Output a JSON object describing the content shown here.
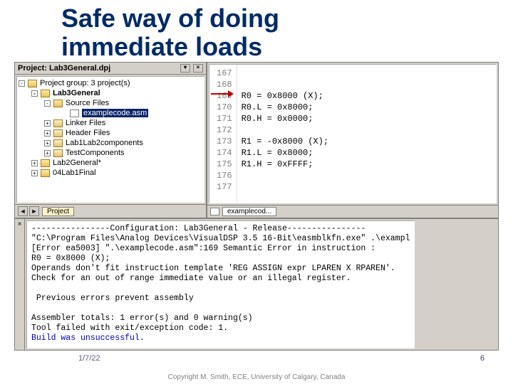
{
  "slide": {
    "title_l1": "Safe way of doing",
    "title_l2": "immediate loads",
    "date": "1/7/22",
    "num": "6",
    "footer": "Copyright M. Smith, ECE, University of Calgary, Canada"
  },
  "project_pane": {
    "title": "Project: Lab3General.dpj",
    "group": "Project group: 3 project(s)",
    "items": {
      "proj": "Lab3General",
      "src": "Source Files",
      "example": "examplecode.asm",
      "linker": "Linker Files",
      "header": "Header Files",
      "lab12": "Lab1Lab2components",
      "testcomp": "TestComponents",
      "lab2g": "Lab2General*",
      "lab1f": "04Lab1Final"
    },
    "tab": "Project"
  },
  "code": {
    "lines": [
      "167",
      "168",
      "169",
      "170",
      "171",
      "172",
      "173",
      "174",
      "175",
      "176",
      "177"
    ],
    "text": "\n\nR0 = 0x8000 (X);\nR0.L = 0x8000;\nR0.H = 0x0000;\n\nR1 = -0x8000 (X);\nR1.L = 0x8000;\nR1.H = 0xFFFF;\n\n",
    "tab": "examplecod..."
  },
  "output": {
    "text": "----------------Configuration: Lab3General - Release----------------\n\"C:\\Program Files\\Analog Devices\\VisualDSP 3.5 16-Bit\\easmblkfn.exe\" .\\exampl\n[Error ea5003] \".\\examplecode.asm\":169 Semantic Error in instruction :\nR0 = 0x8000 (X);\nOperands don't fit instruction template 'REG ASSIGN expr LPAREN X RPAREN'.\nCheck for an out of range immediate value or an illegal register.\n\n Previous errors prevent assembly\n\nAssembler totals: 1 error(s) and 0 warning(s)\nTool failed with exit/exception code: 1.\nBuild was unsuccessful."
  }
}
